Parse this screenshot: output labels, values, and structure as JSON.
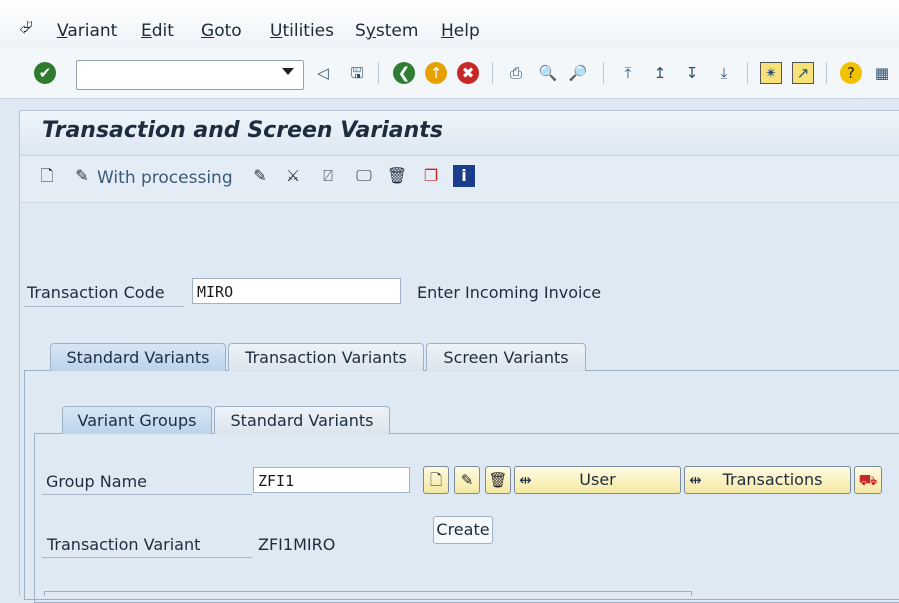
{
  "menu": {
    "items": [
      {
        "key": "V",
        "rest": "ariant"
      },
      {
        "key": "E",
        "rest": "dit"
      },
      {
        "key": "G",
        "rest": "oto"
      },
      {
        "key": "U",
        "rest": "tilities"
      },
      {
        "key": "S",
        "rest": "ystem",
        "pre": "Sy",
        "post": "stem"
      },
      {
        "key": "H",
        "rest": "elp"
      }
    ]
  },
  "command_field": {
    "value": ""
  },
  "page": {
    "title": "Transaction and Screen Variants"
  },
  "app_toolbar": {
    "with_processing": "With processing"
  },
  "form": {
    "tcode_label": "Transaction Code",
    "tcode_value": "MIRO",
    "tcode_desc": "Enter Incoming Invoice"
  },
  "tabs": {
    "outer": [
      "Standard Variants",
      "Transaction Variants",
      "Screen Variants"
    ],
    "inner": [
      "Variant Groups",
      "Standard Variants"
    ]
  },
  "group": {
    "label": "Group Name",
    "value": "ZFI1",
    "user_btn": "User",
    "transactions_btn": "Transactions",
    "create_btn": "Create",
    "tv_label": "Transaction Variant",
    "tv_value": "ZFI1MIRO"
  },
  "colors": {
    "button_bg": "#f5e8a3",
    "panel_bg": "#dfe9f3"
  }
}
